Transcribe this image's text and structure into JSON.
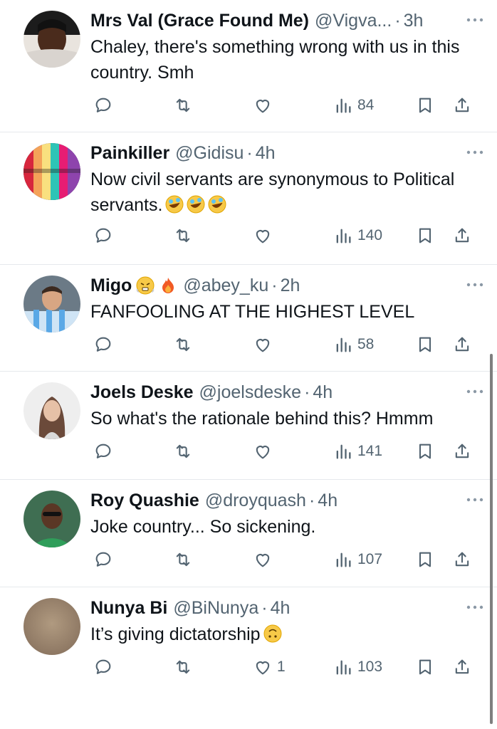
{
  "tweets": [
    {
      "name": "Mrs Val (Grace Found Me)",
      "handle": "@Vigva...",
      "sep": "·",
      "time": "3h",
      "text": "Chaley, there's something wrong with us in this country. Smh",
      "views": "84",
      "likes": "",
      "avatar_icon": "profile-photo-icon"
    },
    {
      "name": "Painkiller",
      "handle": "@Gidisu",
      "sep": "·",
      "time": "4h",
      "text": "Now civil servants are synonymous to Political servants.",
      "text_emoji": "rolling-on-floor-laughing-emoji x3",
      "views": "140",
      "likes": "",
      "avatar_icon": "macarons-photo-icon"
    },
    {
      "name": "Migo",
      "name_emoji": "steam-face-emoji, fire-emoji",
      "handle": "@abey_ku",
      "sep": "·",
      "time": "2h",
      "text": "FANFOOLING AT THE HIGHEST LEVEL",
      "views": "58",
      "likes": "",
      "avatar_icon": "football-player-photo-icon"
    },
    {
      "name": "Joels Deske",
      "handle": "@joelsdeske",
      "sep": "·",
      "time": "4h",
      "text": "So what's the rationale behind this? Hmmm",
      "views": "141",
      "likes": "",
      "avatar_icon": "woman-photo-icon"
    },
    {
      "name": "Roy Quashie",
      "handle": "@droyquash",
      "sep": "·",
      "time": "4h",
      "text": "Joke country... So sickening.",
      "views": "107",
      "likes": "",
      "avatar_icon": "man-photo-icon"
    },
    {
      "name": "Nunya Bi",
      "handle": "@BiNunya",
      "sep": "·",
      "time": "4h",
      "text": "It’s giving dictatorship",
      "text_emoji": "upside-down-face-emoji",
      "views": "103",
      "likes": "1",
      "avatar_icon": "blurred-photo-icon"
    }
  ],
  "colors": {
    "text": "#0f1419",
    "secondary": "#536471",
    "divider": "#e6e9ec"
  }
}
